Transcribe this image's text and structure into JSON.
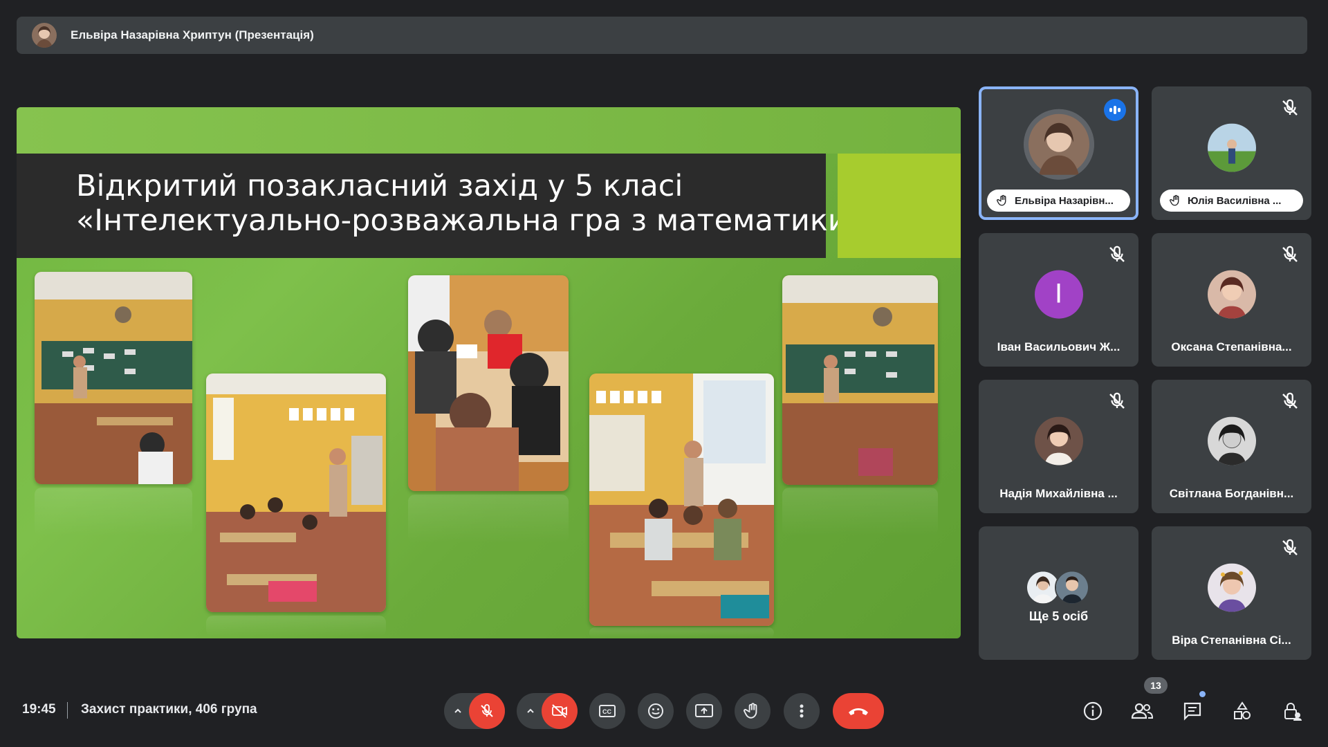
{
  "presenter_bar": {
    "title": "Ельвіра Назарівна Хриптун (Презентація)"
  },
  "slide": {
    "title_line1": "Відкритий позакласний захід у 5 класі",
    "title_line2": "«Інтелектуально-розважальна гра з математики»"
  },
  "participants": [
    {
      "name": "Ельвіра Назарівн...",
      "hand_raised": true,
      "speaking": true,
      "active": true
    },
    {
      "name": "Юлія Василівна ...",
      "hand_raised": true,
      "muted": true
    },
    {
      "name": "Іван Васильович Ж...",
      "avatar_letter": "І",
      "muted": true
    },
    {
      "name": "Оксана Степанівна...",
      "muted": true
    },
    {
      "name": "Надія Михайлівна ...",
      "muted": true
    },
    {
      "name": "Світлана Богданівн...",
      "muted": true
    },
    {
      "name": "Віра Степанівна Сі...",
      "muted": true
    }
  ],
  "more_people": {
    "label": "Ще 5 осіб"
  },
  "bottom": {
    "time": "19:45",
    "meeting_name": "Захист практики, 406 група",
    "people_count": "13"
  },
  "colors": {
    "background": "#202124",
    "tile": "#3c4043",
    "danger": "#ea4335",
    "accent_blue": "#8ab4f8",
    "slide_green": "#6fb63f",
    "slide_accent": "#a7cc2e"
  }
}
